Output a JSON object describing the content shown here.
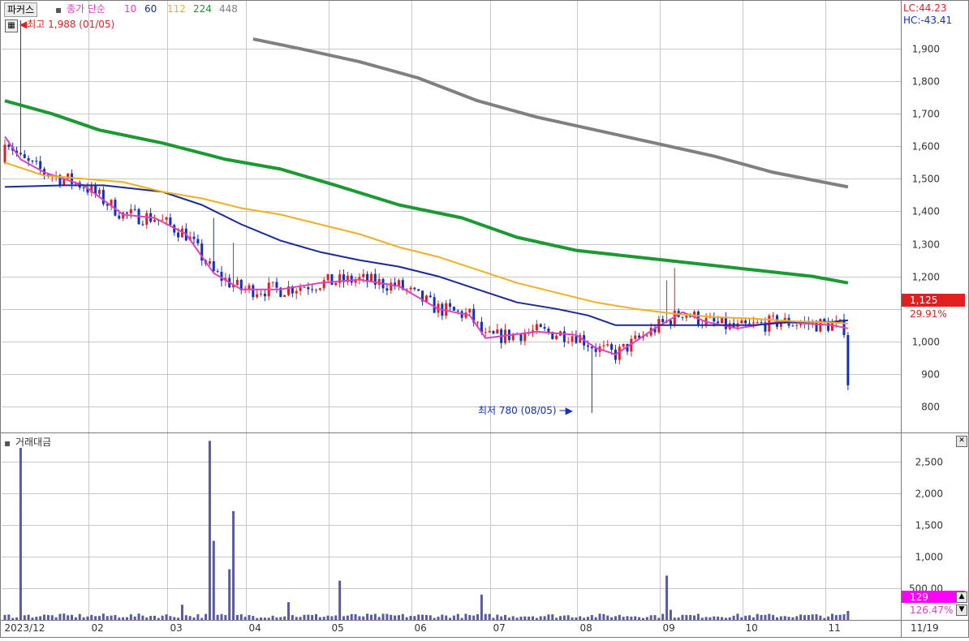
{
  "header": {
    "stock_button": "파커스",
    "indicator_label": "종가 단순",
    "ma_periods": [
      "10",
      "60",
      "112",
      "224",
      "448"
    ],
    "ma_colors": [
      "#e040c0",
      "#1a2a9a",
      "#f0b020",
      "#1a9a30",
      "#808080"
    ],
    "lc_label": "LC:44.23",
    "hc_label": "HC:-43.41",
    "high_marker": "최고 1,988 (01/05)",
    "low_marker": "최저 780 (08/05)",
    "current_price": "1,125",
    "current_pct": "29.91%"
  },
  "volume_panel": {
    "title": "거래대금",
    "current_value": "129",
    "current_pct": "126.47%"
  },
  "x_axis": {
    "months": [
      "2023/12",
      "02",
      "03",
      "04",
      "05",
      "06",
      "07",
      "08",
      "09",
      "10",
      "11"
    ],
    "end_label": "11/19"
  },
  "colors": {
    "up": "#e02020",
    "down": "#1030c0",
    "grid": "#c8c8c8",
    "volume_bar": "#5a5aa0",
    "price_tag_bg": "#e02020",
    "volume_tag_bg": "#ff00ff"
  },
  "chart_data": [
    {
      "type": "candlestick",
      "title": "",
      "y_ticks": [
        800,
        900,
        1000,
        1100,
        1200,
        1300,
        1400,
        1500,
        1600,
        1700,
        1800,
        1900
      ],
      "y_tick_labels": [
        "800",
        "900",
        "1,000",
        "",
        "1,200",
        "1,300",
        "1,400",
        "1,500",
        "1,600",
        "1,700",
        "1,800",
        "1,900"
      ],
      "ylim": [
        720,
        2050
      ],
      "high": {
        "value": 1988,
        "date": "01/05"
      },
      "low": {
        "value": 780,
        "date": "08/05"
      },
      "last_close": 865,
      "moving_averages": [
        {
          "name": "10",
          "color": "#e040c0",
          "points": [
            [
              0,
              1630
            ],
            [
              4,
              1560
            ],
            [
              10,
              1520
            ],
            [
              20,
              1480
            ],
            [
              30,
              1390
            ],
            [
              38,
              1380
            ],
            [
              46,
              1330
            ],
            [
              53,
              1210
            ],
            [
              60,
              1160
            ],
            [
              70,
              1160
            ],
            [
              80,
              1180
            ],
            [
              90,
              1190
            ],
            [
              100,
              1170
            ],
            [
              110,
              1100
            ],
            [
              118,
              1080
            ],
            [
              122,
              1010
            ],
            [
              135,
              1030
            ],
            [
              145,
              1020
            ],
            [
              150,
              980
            ],
            [
              155,
              960
            ],
            [
              165,
              1040
            ],
            [
              172,
              1090
            ],
            [
              178,
              1060
            ],
            [
              186,
              1040
            ],
            [
              196,
              1060
            ],
            [
              210,
              1050
            ],
            [
              214,
              1040
            ]
          ]
        },
        {
          "name": "60",
          "color": "#1a2a9a",
          "points": [
            [
              0,
              1475
            ],
            [
              15,
              1480
            ],
            [
              25,
              1480
            ],
            [
              40,
              1460
            ],
            [
              50,
              1420
            ],
            [
              60,
              1360
            ],
            [
              70,
              1310
            ],
            [
              80,
              1275
            ],
            [
              90,
              1250
            ],
            [
              100,
              1230
            ],
            [
              110,
              1200
            ],
            [
              120,
              1160
            ],
            [
              130,
              1120
            ],
            [
              140,
              1100
            ],
            [
              148,
              1080
            ],
            [
              155,
              1050
            ],
            [
              160,
              1050
            ],
            [
              170,
              1050
            ],
            [
              180,
              1050
            ],
            [
              190,
              1050
            ],
            [
              200,
              1060
            ],
            [
              210,
              1060
            ],
            [
              214,
              1065
            ]
          ]
        },
        {
          "name": "112",
          "color": "#f0b020",
          "points": [
            [
              0,
              1550
            ],
            [
              10,
              1510
            ],
            [
              20,
              1500
            ],
            [
              30,
              1490
            ],
            [
              40,
              1460
            ],
            [
              50,
              1440
            ],
            [
              60,
              1410
            ],
            [
              70,
              1390
            ],
            [
              80,
              1360
            ],
            [
              90,
              1330
            ],
            [
              100,
              1290
            ],
            [
              110,
              1260
            ],
            [
              120,
              1220
            ],
            [
              130,
              1180
            ],
            [
              140,
              1150
            ],
            [
              150,
              1120
            ],
            [
              160,
              1100
            ],
            [
              170,
              1085
            ],
            [
              180,
              1075
            ],
            [
              190,
              1070
            ],
            [
              200,
              1062
            ],
            [
              210,
              1058
            ],
            [
              214,
              1055
            ]
          ]
        },
        {
          "name": "224",
          "color": "#1a9a30",
          "points": [
            [
              0,
              1740
            ],
            [
              12,
              1700
            ],
            [
              24,
              1650
            ],
            [
              40,
              1610
            ],
            [
              56,
              1560
            ],
            [
              70,
              1530
            ],
            [
              84,
              1480
            ],
            [
              100,
              1420
            ],
            [
              116,
              1380
            ],
            [
              130,
              1320
            ],
            [
              145,
              1280
            ],
            [
              160,
              1260
            ],
            [
              175,
              1240
            ],
            [
              190,
              1220
            ],
            [
              205,
              1200
            ],
            [
              214,
              1180
            ]
          ]
        },
        {
          "name": "448",
          "color": "#808080",
          "points": [
            [
              63,
              1930
            ],
            [
              75,
              1900
            ],
            [
              90,
              1860
            ],
            [
              105,
              1810
            ],
            [
              120,
              1740
            ],
            [
              135,
              1690
            ],
            [
              150,
              1650
            ],
            [
              165,
              1610
            ],
            [
              180,
              1570
            ],
            [
              195,
              1520
            ],
            [
              214,
              1475
            ]
          ]
        }
      ]
    },
    {
      "type": "bar",
      "title": "거래대금",
      "y_ticks": [
        500,
        1000,
        1500,
        2000,
        2500
      ],
      "y_tick_labels": [
        "500.00",
        "1,000",
        "1,500",
        "2,000",
        "2,500"
      ],
      "ylim": [
        0,
        2950
      ],
      "last_value": 129,
      "spikes": [
        {
          "index": 4,
          "value": 2720
        },
        {
          "index": 45,
          "value": 240
        },
        {
          "index": 52,
          "value": 2830
        },
        {
          "index": 53,
          "value": 1250
        },
        {
          "index": 57,
          "value": 800
        },
        {
          "index": 58,
          "value": 1720
        },
        {
          "index": 72,
          "value": 280
        },
        {
          "index": 85,
          "value": 620
        },
        {
          "index": 121,
          "value": 400
        },
        {
          "index": 168,
          "value": 700
        },
        {
          "index": 169,
          "value": 160
        }
      ]
    }
  ]
}
